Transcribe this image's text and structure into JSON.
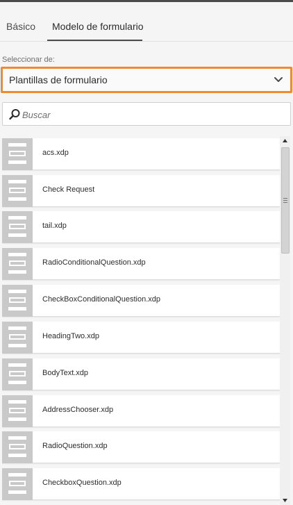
{
  "tabs": [
    {
      "label": "Básico",
      "selected": false
    },
    {
      "label": "Modelo de formulario",
      "selected": true
    }
  ],
  "source": {
    "label": "Seleccionar de:",
    "selected": "Plantillas de formulario"
  },
  "search": {
    "placeholder": "Buscar"
  },
  "templates": [
    {
      "name": "acs.xdp"
    },
    {
      "name": "Check Request"
    },
    {
      "name": "tail.xdp"
    },
    {
      "name": "RadioConditionalQuestion.xdp"
    },
    {
      "name": "CheckBoxConditionalQuestion.xdp"
    },
    {
      "name": "HeadingTwo.xdp"
    },
    {
      "name": "BodyText.xdp"
    },
    {
      "name": "AddressChooser.xdp"
    },
    {
      "name": "RadioQuestion.xdp"
    },
    {
      "name": "CheckboxQuestion.xdp"
    }
  ],
  "colors": {
    "dropdown_focus_border": "#f08a2c",
    "thumbnail_bg": "#c9c9c9",
    "panel_bg": "#f5f5f5"
  },
  "icons": {
    "template_thumbnail": "document-lines-icon",
    "search": "search-icon",
    "dropdown": "chevron-down-icon"
  }
}
